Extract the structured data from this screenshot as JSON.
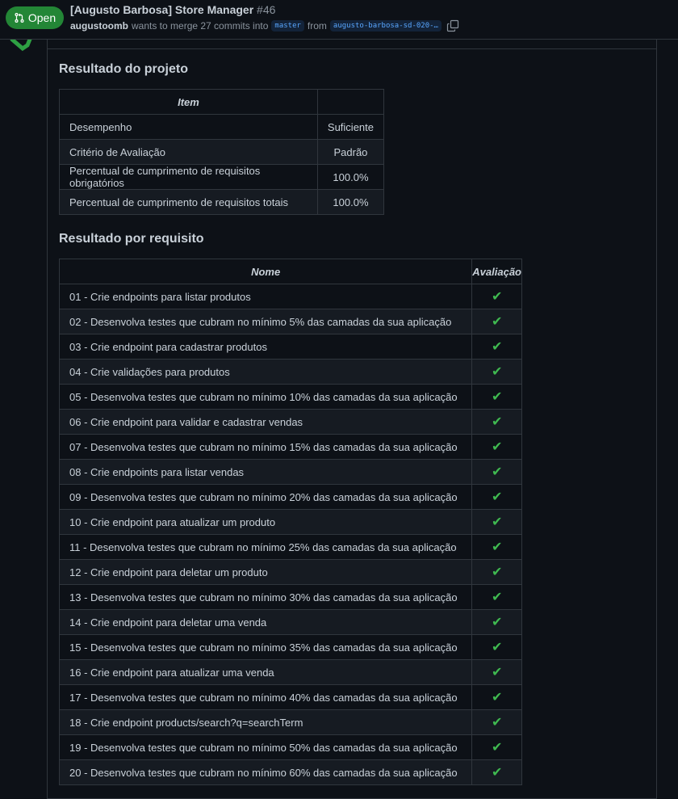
{
  "header": {
    "state": "Open",
    "title": "[Augusto Barbosa] Store Manager",
    "number": "#46",
    "author": "augustoomb",
    "merge_text": "wants to merge 27 commits into",
    "base_branch": "master",
    "from_text": "from",
    "head_branch": "augusto-barbosa-sd-020-…"
  },
  "colors": {
    "open_green": "#238636",
    "check_green": "#3fb950",
    "background": "#0d1117"
  },
  "icons": {
    "state": "git-pull-request-icon",
    "copy": "copy-icon",
    "check": "check-mark-icon"
  },
  "project_result": {
    "heading": "Resultado do projeto",
    "headers": [
      "Item",
      ""
    ],
    "rows": [
      [
        "Desempenho",
        "Suficiente"
      ],
      [
        "Critério de Avaliação",
        "Padrão"
      ],
      [
        "Percentual de cumprimento de requisitos obrigatórios",
        "100.0%"
      ],
      [
        "Percentual de cumprimento de requisitos totais",
        "100.0%"
      ]
    ]
  },
  "requirements": {
    "heading": "Resultado por requisito",
    "headers": [
      "Nome",
      "Avaliação"
    ],
    "check_symbol": "✔",
    "rows": [
      "01 - Crie endpoints para listar produtos",
      "02 - Desenvolva testes que cubram no mínimo 5% das camadas da sua aplicação",
      "03 - Crie endpoint para cadastrar produtos",
      "04 - Crie validações para produtos",
      "05 - Desenvolva testes que cubram no mínimo 10% das camadas da sua aplicação",
      "06 - Crie endpoint para validar e cadastrar vendas",
      "07 - Desenvolva testes que cubram no mínimo 15% das camadas da sua aplicação",
      "08 - Crie endpoints para listar vendas",
      "09 - Desenvolva testes que cubram no mínimo 20% das camadas da sua aplicação",
      "10 - Crie endpoint para atualizar um produto",
      "11 - Desenvolva testes que cubram no mínimo 25% das camadas da sua aplicação",
      "12 - Crie endpoint para deletar um produto",
      "13 - Desenvolva testes que cubram no mínimo 30% das camadas da sua aplicação",
      "14 - Crie endpoint para deletar uma venda",
      "15 - Desenvolva testes que cubram no mínimo 35% das camadas da sua aplicação",
      "16 - Crie endpoint para atualizar uma venda",
      "17 - Desenvolva testes que cubram no mínimo 40% das camadas da sua aplicação",
      "18 - Crie endpoint products/search?q=searchTerm",
      "19 - Desenvolva testes que cubram no mínimo 50% das camadas da sua aplicação",
      "20 - Desenvolva testes que cubram no mínimo 60% das camadas da sua aplicação"
    ]
  }
}
